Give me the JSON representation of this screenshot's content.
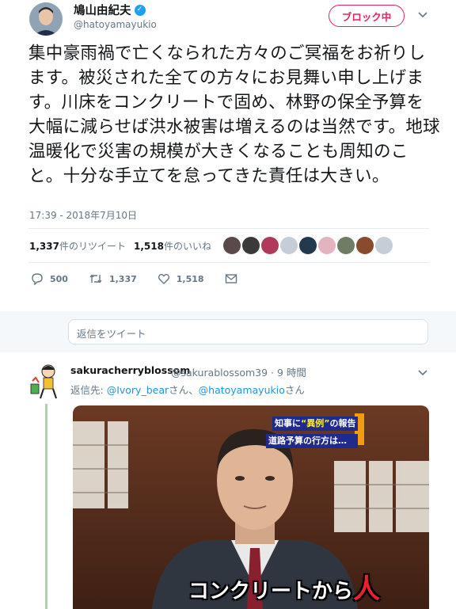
{
  "tweet": {
    "display_name": "鳩山由紀夫",
    "handle": "@hatoyamayukio",
    "block_label": "ブロック中",
    "text": "集中豪雨禍で亡くなられた方々のご冥福をお祈りします。被災された全ての方々にお見舞い申し上げます。川床をコンクリートで固め、林野の保全予算を大幅に減らせば洪水被害は増えるのは当然です。地球温暖化で災害の規模が大きくなることも周知のこと。十分な手立てを怠ってきた責任は大きい。",
    "timestamp": "17:39 - 2018年7月10日",
    "retweet_count": "1,337",
    "retweet_label": "件のリツイート",
    "like_count": "1,518",
    "like_label": "件のいいね",
    "reply_count": "500",
    "action_retweets": "1,337",
    "action_likes": "1,518"
  },
  "reply_box": {
    "placeholder": "返信をツイート"
  },
  "reply": {
    "display_name": "sakuracherryblossom",
    "handle": "@sakurablossom39",
    "time": "· 9 時間",
    "reply_to_prefix": "返信先: ",
    "mention1": "@Ivory_bear",
    "san1": "さん、",
    "mention2": "@hatoyamayukio",
    "san2": "さん",
    "image": {
      "ticker_line1_a": "知事に",
      "ticker_line1_b": "“異例”",
      "ticker_line1_c": "の報告",
      "ticker_line2": "道路予算の行方は…",
      "caption_a": "コンクリートから",
      "caption_b": "人"
    }
  },
  "colors": {
    "accent": "#1da1f2",
    "block": "#e0245e",
    "mention": "#1b95e0",
    "thread_line": "#a5d6a7"
  },
  "icons": [
    "verified-icon",
    "chevron-down-icon",
    "reply-icon",
    "retweet-icon",
    "like-icon",
    "message-icon"
  ]
}
